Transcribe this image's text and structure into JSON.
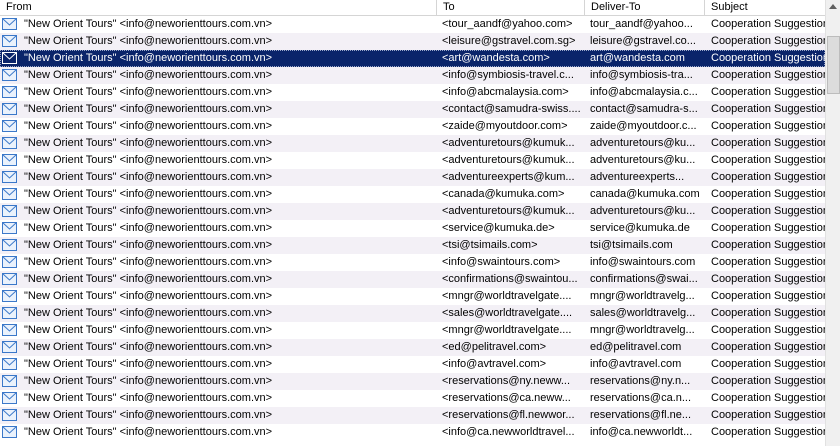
{
  "columns": {
    "from": "From",
    "to": "To",
    "deliver_to": "Deliver-To",
    "subject": "Subject"
  },
  "selected_index": 2,
  "rows": [
    {
      "from": "\"New Orient Tours\" <info@neworienttours.com.vn>",
      "to": "<tour_aandf@yahoo.com>",
      "deliver_to": "tour_aandf@yahoo...",
      "subject": "Cooperation Suggestion"
    },
    {
      "from": "\"New Orient Tours\" <info@neworienttours.com.vn>",
      "to": "<leisure@gstravel.com.sg>",
      "deliver_to": "leisure@gstravel.co...",
      "subject": "Cooperation Suggestion"
    },
    {
      "from": "\"New Orient Tours\" <info@neworienttours.com.vn>",
      "to": "<art@wandesta.com>",
      "deliver_to": "art@wandesta.com",
      "subject": "Cooperation Suggestion"
    },
    {
      "from": "\"New Orient Tours\" <info@neworienttours.com.vn>",
      "to": "<info@symbiosis-travel.c...",
      "deliver_to": "info@symbiosis-tra...",
      "subject": "Cooperation Suggestion"
    },
    {
      "from": "\"New Orient Tours\" <info@neworienttours.com.vn>",
      "to": "<info@abcmalaysia.com>",
      "deliver_to": "info@abcmalaysia.c...",
      "subject": "Cooperation Suggestion"
    },
    {
      "from": "\"New Orient Tours\" <info@neworienttours.com.vn>",
      "to": "<contact@samudra-swiss....",
      "deliver_to": "contact@samudra-s...",
      "subject": "Cooperation Suggestion"
    },
    {
      "from": "\"New Orient Tours\" <info@neworienttours.com.vn>",
      "to": "<zaide@myoutdoor.com>",
      "deliver_to": "zaide@myoutdoor.c...",
      "subject": "Cooperation Suggestion"
    },
    {
      "from": "\"New Orient Tours\" <info@neworienttours.com.vn>",
      "to": "<adventuretours@kumuk...",
      "deliver_to": "adventuretours@ku...",
      "subject": "Cooperation Suggestion"
    },
    {
      "from": "\"New Orient Tours\" <info@neworienttours.com.vn>",
      "to": "<adventuretours@kumuk...",
      "deliver_to": "adventuretours@ku...",
      "subject": "Cooperation Suggestion"
    },
    {
      "from": "\"New Orient Tours\" <info@neworienttours.com.vn>",
      "to": "<adventureexperts@kum...",
      "deliver_to": "adventureexperts...",
      "subject": "Cooperation Suggestion"
    },
    {
      "from": "\"New Orient Tours\" <info@neworienttours.com.vn>",
      "to": "<canada@kumuka.com>",
      "deliver_to": "canada@kumuka.com",
      "subject": "Cooperation Suggestion"
    },
    {
      "from": "\"New Orient Tours\" <info@neworienttours.com.vn>",
      "to": "<adventuretours@kumuk...",
      "deliver_to": "adventuretours@ku...",
      "subject": "Cooperation Suggestion"
    },
    {
      "from": "\"New Orient Tours\" <info@neworienttours.com.vn>",
      "to": "<service@kumuka.de>",
      "deliver_to": "service@kumuka.de",
      "subject": "Cooperation Suggestion"
    },
    {
      "from": "\"New Orient Tours\" <info@neworienttours.com.vn>",
      "to": "<tsi@tsimails.com>",
      "deliver_to": "tsi@tsimails.com",
      "subject": "Cooperation Suggestion"
    },
    {
      "from": "\"New Orient Tours\" <info@neworienttours.com.vn>",
      "to": "<info@swaintours.com>",
      "deliver_to": "info@swaintours.com",
      "subject": "Cooperation Suggestion"
    },
    {
      "from": "\"New Orient Tours\" <info@neworienttours.com.vn>",
      "to": "<confirmations@swaintou...",
      "deliver_to": "confirmations@swai...",
      "subject": "Cooperation Suggestion"
    },
    {
      "from": "\"New Orient Tours\" <info@neworienttours.com.vn>",
      "to": "<mngr@worldtravelgate....",
      "deliver_to": "mngr@worldtravelg...",
      "subject": "Cooperation Suggestion"
    },
    {
      "from": "\"New Orient Tours\" <info@neworienttours.com.vn>",
      "to": "<sales@worldtravelgate....",
      "deliver_to": "sales@worldtravelg...",
      "subject": "Cooperation Suggestion"
    },
    {
      "from": "\"New Orient Tours\" <info@neworienttours.com.vn>",
      "to": "<mngr@worldtravelgate....",
      "deliver_to": "mngr@worldtravelg...",
      "subject": "Cooperation Suggestion"
    },
    {
      "from": "\"New Orient Tours\" <info@neworienttours.com.vn>",
      "to": "<ed@pelitravel.com>",
      "deliver_to": "ed@pelitravel.com",
      "subject": "Cooperation Suggestion"
    },
    {
      "from": "\"New Orient Tours\" <info@neworienttours.com.vn>",
      "to": "<info@avtravel.com>",
      "deliver_to": "info@avtravel.com",
      "subject": "Cooperation Suggestion"
    },
    {
      "from": "\"New Orient Tours\" <info@neworienttours.com.vn>",
      "to": "<reservations@ny.neww...",
      "deliver_to": "reservations@ny.n...",
      "subject": "Cooperation Suggestion"
    },
    {
      "from": "\"New Orient Tours\" <info@neworienttours.com.vn>",
      "to": "<reservations@ca.neww...",
      "deliver_to": "reservations@ca.n...",
      "subject": "Cooperation Suggestion"
    },
    {
      "from": "\"New Orient Tours\" <info@neworienttours.com.vn>",
      "to": "<reservations@fl.newwor...",
      "deliver_to": "reservations@fl.ne...",
      "subject": "Cooperation Suggestion"
    },
    {
      "from": "\"New Orient Tours\" <info@neworienttours.com.vn>",
      "to": "<info@ca.newworldtravel...",
      "deliver_to": "info@ca.newworldt...",
      "subject": "Cooperation Suggestion"
    }
  ],
  "icons": {
    "row_icon": "envelope-icon",
    "scroll_up": "scroll-up-arrow-icon"
  },
  "colors": {
    "selection": "#0a246a",
    "alt_row": "#f3f0f6",
    "icon": "#3b78c9"
  }
}
